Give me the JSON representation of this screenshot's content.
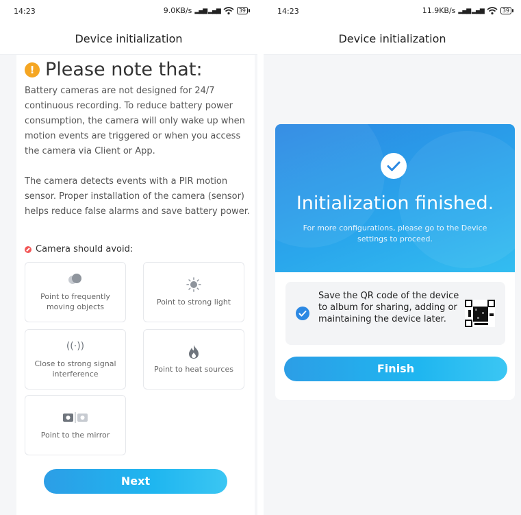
{
  "left": {
    "status": {
      "time": "14:23",
      "speed": "9.0KB/s",
      "signal": "²⁶ıll ⁴⁶ıll",
      "battery": "39"
    },
    "title": "Device initialization",
    "note_title": "Please note that:",
    "paragraph_1": "Battery cameras are not designed for 24/7 continuous recording. To reduce battery power consumption, the camera will only wake up when motion events are triggered or when you access the camera via Client or App.",
    "paragraph_2": "The camera detects events with a PIR motion sensor. Proper installation of the camera (sensor) helps reduce false alarms and save battery power.",
    "avoid_heading": "Camera should avoid:",
    "tiles": [
      {
        "icon": "moving-objects-icon",
        "label": "Point to frequently moving objects"
      },
      {
        "icon": "sun-icon",
        "label": "Point to strong light"
      },
      {
        "icon": "signal-icon",
        "glyph": "((·))",
        "label": "Close to strong signal interference"
      },
      {
        "icon": "flame-icon",
        "label": "Point to heat sources"
      },
      {
        "icon": "mirror-icon",
        "label": "Point to the mirror"
      }
    ],
    "next_label": "Next"
  },
  "right": {
    "status": {
      "time": "14:23",
      "speed": "11.9KB/s",
      "signal": "ıll ıll",
      "battery": "39"
    },
    "title": "Device initialization",
    "init_title": "Initialization finished.",
    "init_subtitle": "For more configurations, please go to the Device settings to proceed.",
    "qr_text": "Save the QR code of the device to album for sharing, adding or maintaining the device later.",
    "qr_checked": true,
    "finish_label": "Finish"
  },
  "colors": {
    "accent": "#2b88e3",
    "button_start": "#2c9ee6",
    "button_end": "#3bc6f3",
    "warning": "#f5a623",
    "avoid": "#f25757"
  }
}
